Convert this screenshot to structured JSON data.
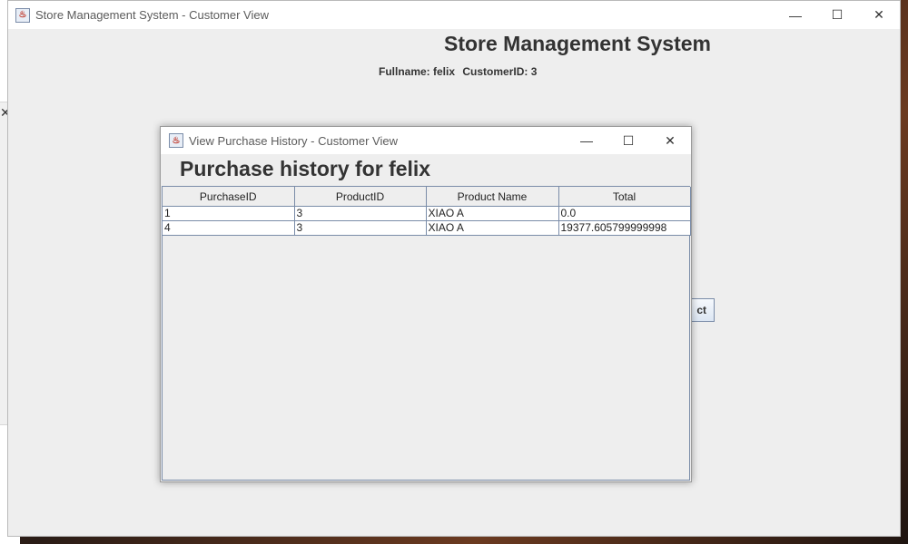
{
  "main_window": {
    "title": "Store Management System - Customer View",
    "heading": "Store Management System",
    "fullname_label": "Fullname: felix",
    "customer_id_label": "CustomerID: 3",
    "partial_button_label": "ct"
  },
  "dialog": {
    "title": "View Purchase History - Customer View",
    "heading": "Purchase history for felix",
    "table": {
      "headers": [
        "PurchaseID",
        "ProductID",
        "Product Name",
        "Total"
      ],
      "rows": [
        [
          "1",
          "3",
          "XIAO A",
          "0.0"
        ],
        [
          "4",
          "3",
          "XIAO A",
          "19377.605799999998"
        ]
      ]
    }
  },
  "window_controls": {
    "minimize": "—",
    "maximize": "☐",
    "close": "✕"
  },
  "icons": [
    "java-app-icon",
    "minimize-icon",
    "maximize-icon",
    "close-icon"
  ]
}
